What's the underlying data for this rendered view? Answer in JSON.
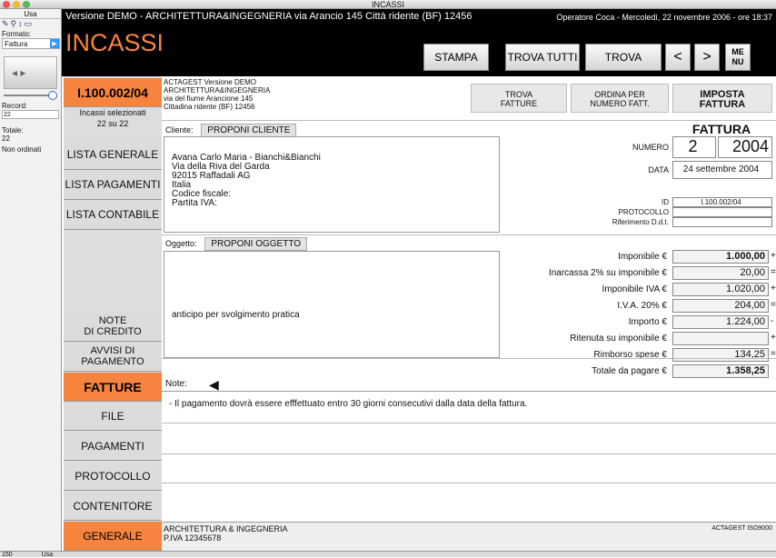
{
  "window": {
    "title": "INCASSI"
  },
  "left_strip": {
    "usa": "Usa",
    "formato_label": "Formato:",
    "formato_value": "Fattura",
    "record_label": "Record:",
    "record_value": "22",
    "totale_label": "Totale:",
    "totale_value": "22",
    "non_ordinati": "Non ordinati",
    "status_zoom": "150",
    "status_mode": "Usa"
  },
  "header": {
    "demo_line": "Versione DEMO - ARCHITETTURA&INGEGNERIA via Arancio 145 Città ridente (BF) 12456",
    "operator_line": "Operatore Coca - Mercoledì, 22 novembre 2006 - ore 18:37",
    "title": "INCASSI",
    "buttons": {
      "stampa": "STAMPA",
      "trova_tutti": "TROVA TUTTI",
      "trova": "TROVA",
      "prev": "<",
      "next": ">",
      "menu_line1": "ME",
      "menu_line2": "NU"
    }
  },
  "sidebar": {
    "record_id": "I.100.002/04",
    "selected_label": "Incassi selezionati",
    "selected_count": "22 su 22",
    "lista_generale": "LISTA GENERALE",
    "lista_pagamenti": "LISTA PAGAMENTI",
    "lista_contabile": "LISTA CONTABILE",
    "note_credito_1": "NOTE",
    "note_credito_2": "DI CREDITO",
    "avvisi_1": "AVVISI DI",
    "avvisi_2": "PAGAMENTO",
    "fatture": "FATTURE",
    "file": "FILE",
    "pagamenti": "PAGAMENTI",
    "protocollo": "PROTOCOLLO",
    "contenitore": "CONTENITORE",
    "generale": "GENERALE"
  },
  "company": {
    "line1": "ACTAGEST Versione DEMO",
    "line2": "ARCHITETTURA&INGEGNERIA",
    "line3": "via del fiume Arancione 145",
    "line4": "Cittadina ridente (BF) 12456"
  },
  "actions": {
    "trova_fatture_1": "TROVA",
    "trova_fatture_2": "FATTURE",
    "ordina_1": "ORDINA PER",
    "ordina_2": "NUMERO FATT.",
    "imposta_1": "IMPOSTA",
    "imposta_2": "FATTURA"
  },
  "invoice": {
    "heading": "FATTURA",
    "numero_label": "NUMERO",
    "numero": "2",
    "anno": "2004",
    "data_label": "DATA",
    "data": "24 settembre 2004",
    "id_label": "ID",
    "id_value": "I.100.002/04",
    "protocollo_label": "PROTOCOLLO",
    "protocollo_value": "",
    "ddt_label": "Riferimento D.d.t.",
    "ddt_value": ""
  },
  "cliente": {
    "label": "Cliente:",
    "button": "PROPONI CLIENTE",
    "name": "Avana Carlo Maria - Bianchi&Bianchi",
    "street": "Via della Riva del Garda",
    "city": "92015 Raffadali  AG",
    "country": "Italia",
    "cf": "Codice fiscale:",
    "piva": "Partita IVA:"
  },
  "oggetto": {
    "label": "Oggetto:",
    "button": "PROPONI OGGETTO",
    "text": "anticipo per svolgimento pratica"
  },
  "amounts": [
    {
      "label": "Imponibile €",
      "value": "1.000,00",
      "bold": true,
      "sign": "+"
    },
    {
      "label": "Inarcassa 2% su imponibile €",
      "value": "20,00",
      "bold": false,
      "sign": "="
    },
    {
      "label": "Imponibile IVA €",
      "value": "1.020,00",
      "bold": false,
      "sign": "+"
    },
    {
      "label": "I.V.A. 20% €",
      "value": "204,00",
      "bold": false,
      "sign": "="
    },
    {
      "label": "Importo €",
      "value": "1.224,00",
      "bold": false,
      "sign": "-"
    },
    {
      "label": "Ritenuta  su imponibile €",
      "value": "",
      "bold": false,
      "sign": "+"
    },
    {
      "label": "Rimborso spese €",
      "value": "134,25",
      "bold": false,
      "sign": "="
    },
    {
      "label": "Totale da pagare €",
      "value": "1.358,25",
      "bold": true,
      "sign": ""
    }
  ],
  "note": {
    "label": "Note:",
    "text": "- Il pagamento dovrà essere efffettuato entro 30 giorni consecutivi dalla data della fattura."
  },
  "footer": {
    "line1": "ARCHITETTURA & INGEGNERIA",
    "line2": "P.IVA 12345678",
    "right": "ACTAGEST ISO9000"
  }
}
